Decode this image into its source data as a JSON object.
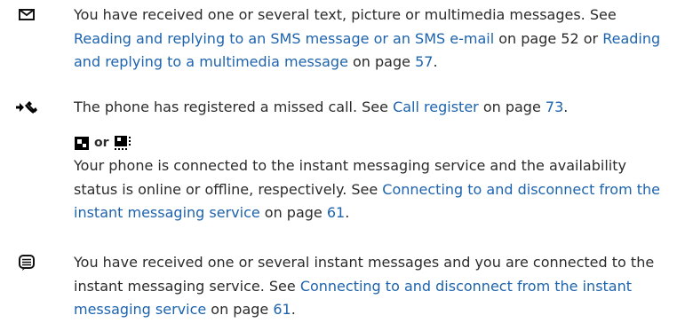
{
  "entries": [
    {
      "icon": "envelope-icon",
      "t1": "You have received one or several text, picture or multimedia messages. See ",
      "l1": "Reading and replying to an SMS message or an SMS e-mail",
      "t2": " on page 52 or ",
      "l2": "Reading and replying to a multimedia message",
      "t3": " on page ",
      "l3": "57",
      "t4": "."
    },
    {
      "icon": "missed-call-icon",
      "t1": "The phone has registered a missed call. See ",
      "l1": "Call register",
      "t2": " on page ",
      "l2": "73",
      "t3": "."
    },
    {
      "icons": [
        "im-online-icon",
        "im-offline-icon"
      ],
      "or": "or",
      "t1": "Your phone is connected to the instant messaging service and the availability status is online or offline, respectively. See ",
      "l1": "Connecting to and disconnect from the instant messaging service",
      "t2": " on page ",
      "l2": "61",
      "t3": "."
    },
    {
      "icon": "instant-message-icon",
      "t1": "You have received one or several instant messages and you are connected to the instant messaging service. See ",
      "l1": "Connecting to and disconnect from the instant messaging service",
      "t2": " on page ",
      "l2": "61",
      "t3": "."
    }
  ]
}
